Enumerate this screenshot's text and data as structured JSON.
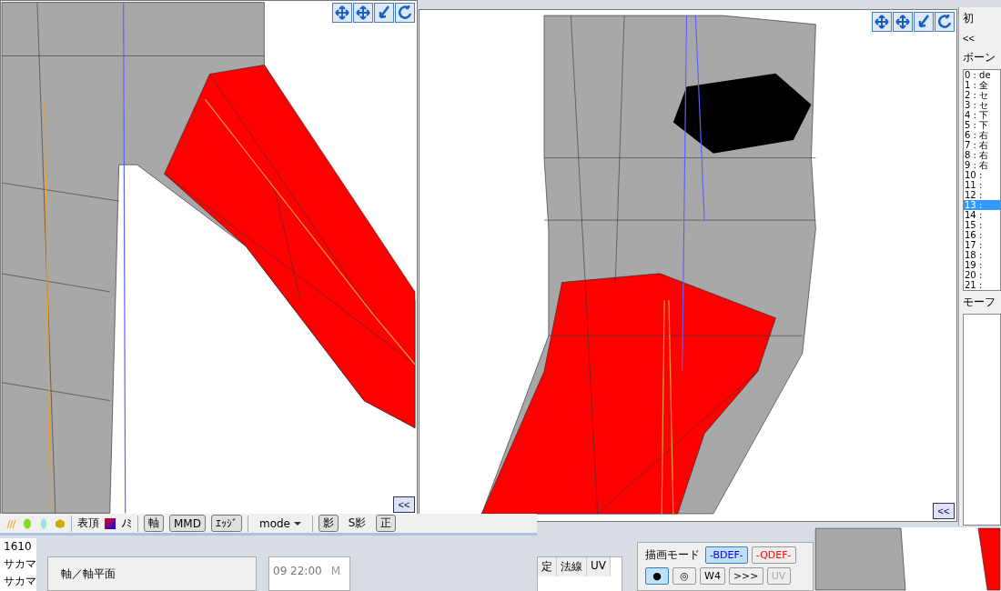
{
  "left_view": {
    "collapse_button": "<<"
  },
  "right_view": {
    "collapse_button": "<<"
  },
  "side_panel": {
    "top_label": "初",
    "nav_button": "<<",
    "bone_title": "ボーン",
    "morph_title": "モーフ",
    "bones": [
      {
        "label": "0 : de",
        "selected": false
      },
      {
        "label": "1 : 全",
        "selected": false
      },
      {
        "label": "2 : セ",
        "selected": false
      },
      {
        "label": "3 : セ",
        "selected": false
      },
      {
        "label": "4 : 下",
        "selected": false
      },
      {
        "label": "5 : 下",
        "selected": false
      },
      {
        "label": "6 : 右",
        "selected": false
      },
      {
        "label": "7 : 右",
        "selected": false
      },
      {
        "label": "8 : 右",
        "selected": false
      },
      {
        "label": "9 : 右",
        "selected": false
      },
      {
        "label": "10 :",
        "selected": false
      },
      {
        "label": "11 :",
        "selected": false
      },
      {
        "label": "12 :",
        "selected": false
      },
      {
        "label": "13 :",
        "selected": true
      },
      {
        "label": "14 :",
        "selected": false
      },
      {
        "label": "15 :",
        "selected": false
      },
      {
        "label": "16 :",
        "selected": false
      },
      {
        "label": "17 :",
        "selected": false
      },
      {
        "label": "18 :",
        "selected": false
      },
      {
        "label": "19 :",
        "selected": false
      },
      {
        "label": "20 :",
        "selected": false
      },
      {
        "label": "21 :",
        "selected": false
      }
    ]
  },
  "toolbar": {
    "face_label": "表頂",
    "weight_label": "ﾉﾐ",
    "mode_dropdown": "mode",
    "toggles": [
      {
        "label": "軸",
        "on": true
      },
      {
        "label": "MMD",
        "on": true
      },
      {
        "label": "ｴｯｼﾞ",
        "on": true
      }
    ],
    "shadow_toggles": [
      {
        "label": "影",
        "on": true
      },
      {
        "label": "S影",
        "on": false
      },
      {
        "label": "正",
        "on": true
      }
    ]
  },
  "file_list": {
    "rows": [
      "1610",
      "サカマ",
      "サカマ"
    ]
  },
  "axis_panel": {
    "group_title": "軸／軸平面"
  },
  "date_list": {
    "rows": [
      {
        "date": "09 22:00",
        "type": "M"
      }
    ]
  },
  "table": {
    "columns": [
      "定",
      "法線",
      "UV"
    ]
  },
  "weight_panel": {
    "title": "描画モード",
    "modes": [
      {
        "label": "-BDEF-",
        "selected": true,
        "color": "#0000ff"
      },
      {
        "label": "-QDEF-",
        "selected": false,
        "color": "#ff0000"
      }
    ],
    "tools": [
      {
        "label": "●",
        "selected": true,
        "disabled": false
      },
      {
        "label": "◎",
        "selected": false,
        "disabled": false
      },
      {
        "label": "W4",
        "selected": false,
        "disabled": false
      },
      {
        "label": ">>>",
        "selected": false,
        "disabled": false
      },
      {
        "label": "UV",
        "selected": false,
        "disabled": true
      }
    ]
  }
}
